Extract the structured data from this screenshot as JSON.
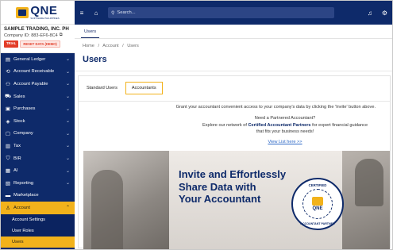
{
  "brand": {
    "logo_text": "QNE",
    "logo_sub": "SOFTWARE PHILIPPINES"
  },
  "company": {
    "name": "SAMPLE TRADING, INC. PH",
    "id": "Company ID: 883-EF6-8C4",
    "badge_trial": "TRIAL",
    "badge_reset": "RESET DATA (DEMO)"
  },
  "sidebar": {
    "items": [
      {
        "label": "General Ledger",
        "icon": "book-icon"
      },
      {
        "label": "Account Receivable",
        "icon": "receivable-icon"
      },
      {
        "label": "Account Payable",
        "icon": "payable-icon"
      },
      {
        "label": "Sales",
        "icon": "sales-icon"
      },
      {
        "label": "Purchases",
        "icon": "purchases-icon"
      },
      {
        "label": "Stock",
        "icon": "stock-icon"
      },
      {
        "label": "Company",
        "icon": "company-icon"
      },
      {
        "label": "Tax",
        "icon": "tax-icon"
      },
      {
        "label": "BIR",
        "icon": "bir-icon"
      },
      {
        "label": "AI",
        "icon": "ai-icon"
      },
      {
        "label": "Reporting",
        "icon": "reporting-icon"
      },
      {
        "label": "Marketplace",
        "icon": "marketplace-icon"
      },
      {
        "label": "Account",
        "icon": "user-icon"
      }
    ],
    "sub_items": [
      {
        "label": "Account Settings"
      },
      {
        "label": "User Roles"
      },
      {
        "label": "Users"
      }
    ]
  },
  "topbar": {
    "search_placeholder": "Search..."
  },
  "main": {
    "top_tab": "Users",
    "breadcrumb": [
      "Home",
      "/",
      "Account",
      "/",
      "Users"
    ],
    "title": "Users",
    "tabs": [
      "Standard Users",
      "Accountants"
    ],
    "message_access": "Grant your accountant convenient access to your company's data by clicking the 'Invite' button above.",
    "message_need": "Need a Partnered Accountant?",
    "message_explore_pre": "Explore our network of",
    "message_explore_bold": "Certified Accountant Partners",
    "message_explore_post": "for expert financial guidance",
    "message_needs": "that fits your business needs!",
    "view_list_link": "View List here >>",
    "banner_line1": "Invite and Effortlessly",
    "banner_line2": "Share Data with",
    "banner_line3": "Your Accountant",
    "seal_top": "CERTIFIED",
    "seal_logo": "QNE",
    "seal_bottom": "ACCOUNTANT PARTNER"
  },
  "colors": {
    "navy": "#0e2a6a",
    "accent": "#f2b21b",
    "link": "#2b67c6"
  }
}
